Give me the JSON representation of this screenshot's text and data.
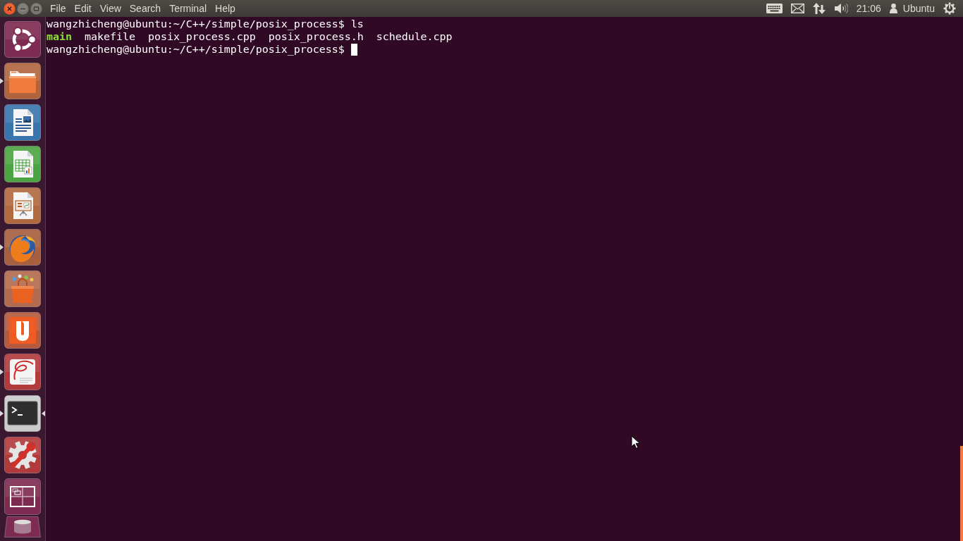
{
  "top_bar": {
    "window_controls": [
      {
        "kind": "close"
      },
      {
        "kind": "minimize"
      },
      {
        "kind": "maximize"
      }
    ],
    "menu": [
      "File",
      "Edit",
      "View",
      "Search",
      "Terminal",
      "Help"
    ],
    "indicators": [
      {
        "kind": "keyboard"
      },
      {
        "kind": "mail"
      },
      {
        "kind": "network"
      },
      {
        "kind": "volume"
      },
      {
        "kind": "clock",
        "text": "21:06"
      },
      {
        "kind": "user",
        "text": "Ubuntu"
      },
      {
        "kind": "session"
      }
    ]
  },
  "launcher": {
    "items": [
      {
        "kind": "dash",
        "running": false,
        "focused": false
      },
      {
        "kind": "files",
        "running": true,
        "focused": false
      },
      {
        "kind": "writer",
        "running": false,
        "focused": false
      },
      {
        "kind": "calc",
        "running": false,
        "focused": false
      },
      {
        "kind": "impress",
        "running": false,
        "focused": false
      },
      {
        "kind": "browser",
        "running": true,
        "focused": false
      },
      {
        "kind": "software",
        "running": false,
        "focused": false
      },
      {
        "kind": "cloud",
        "running": false,
        "focused": false
      },
      {
        "kind": "viewer",
        "running": true,
        "focused": false
      },
      {
        "kind": "terminal",
        "running": true,
        "focused": true
      },
      {
        "kind": "settings",
        "running": false,
        "focused": false
      },
      {
        "kind": "workspaces",
        "running": false,
        "focused": false
      },
      {
        "kind": "trash",
        "running": false,
        "focused": false
      }
    ]
  },
  "terminal": {
    "lines": [
      {
        "kind": "prompt",
        "prompt": "wangzhicheng@ubuntu:~/C++/simple/posix_process$",
        "command": "ls",
        "cursor": false
      },
      {
        "kind": "listing",
        "entries": [
          {
            "name": "main",
            "executable": true
          },
          {
            "name": "makefile",
            "executable": false
          },
          {
            "name": "posix_process.cpp",
            "executable": false
          },
          {
            "name": "posix_process.h",
            "executable": false
          },
          {
            "name": "schedule.cpp",
            "executable": false
          }
        ]
      },
      {
        "kind": "prompt",
        "prompt": "wangzhicheng@ubuntu:~/C++/simple/posix_process$",
        "cursor": true
      }
    ]
  }
}
